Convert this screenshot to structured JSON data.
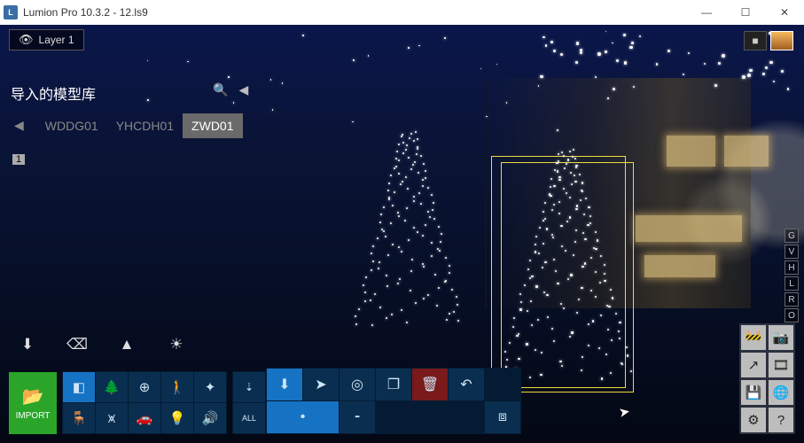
{
  "titlebar": {
    "app_icon_text": "L",
    "title": "Lumion Pro 10.3.2  - 12.ls9",
    "min": "—",
    "max": "☐",
    "close": "✕"
  },
  "layer_button": {
    "label": "Layer 1"
  },
  "library": {
    "title": "导入的模型库",
    "tabs": [
      "WDDG01",
      "YHCDH01",
      "ZWD01"
    ],
    "active_index": 2,
    "page": "1"
  },
  "top_thumbs": {
    "labels": [
      "camera",
      "scene"
    ],
    "active_index": 1
  },
  "rnav_letters": [
    "G",
    "V",
    "H",
    "L",
    "R",
    "O"
  ],
  "right_tools": {
    "items": [
      {
        "name": "worker-icon",
        "glyph": "🚧"
      },
      {
        "name": "camera-icon",
        "glyph": "📷"
      },
      {
        "name": "export-icon",
        "glyph": "↗"
      },
      {
        "name": "film-icon",
        "glyph": "🎞"
      },
      {
        "name": "save-icon",
        "glyph": "💾"
      },
      {
        "name": "globe-icon",
        "glyph": "🌐"
      },
      {
        "name": "gear-icon",
        "glyph": "⚙"
      },
      {
        "name": "help-icon",
        "glyph": "?"
      }
    ]
  },
  "mode_row": {
    "items": [
      {
        "name": "place-down-icon",
        "glyph": "⬇"
      },
      {
        "name": "eraser-icon",
        "glyph": "⌫"
      },
      {
        "name": "mountain-icon",
        "glyph": "▲"
      },
      {
        "name": "sun-icon",
        "glyph": "☀"
      }
    ]
  },
  "import_btn": {
    "label": "IMPORT"
  },
  "object_grid": {
    "row1": [
      {
        "name": "cube-icon",
        "glyph": "◧"
      },
      {
        "name": "tree-icon",
        "glyph": "🌲"
      },
      {
        "name": "tree-plus-icon",
        "glyph": "⊕"
      },
      {
        "name": "walk-icon",
        "glyph": "🚶"
      },
      {
        "name": "tools-icon",
        "glyph": "✦"
      }
    ],
    "row2": [
      {
        "name": "chair-icon",
        "glyph": "🪑"
      },
      {
        "name": "fence-icon",
        "glyph": "⩙"
      },
      {
        "name": "car-icon",
        "glyph": "🚗"
      },
      {
        "name": "light-icon",
        "glyph": "💡"
      },
      {
        "name": "sound-icon",
        "glyph": "🔊"
      }
    ],
    "active_index": 0
  },
  "side_col": {
    "top_glyph": "⇣",
    "all_label": "ALL"
  },
  "placement": {
    "row1": [
      {
        "name": "place-icon",
        "glyph": "⬇",
        "active": true
      },
      {
        "name": "pointer-icon",
        "glyph": "➤"
      },
      {
        "name": "rotate-icon",
        "glyph": "◎"
      },
      {
        "name": "scale-icon",
        "glyph": "❐"
      },
      {
        "name": "delete-icon",
        "glyph": "🗑",
        "del": true
      },
      {
        "name": "undo-icon",
        "glyph": "↶"
      },
      {
        "name": "blank1",
        "glyph": "",
        "blank": true
      }
    ],
    "row2": [
      {
        "name": "single-place-icon",
        "glyph": "•",
        "span2": true,
        "active": true
      },
      {
        "name": "line-place-icon",
        "glyph": "⁃"
      },
      {
        "name": "blank2",
        "glyph": "",
        "blank": true
      },
      {
        "name": "blank3",
        "glyph": "",
        "blank": true
      },
      {
        "name": "blank4",
        "glyph": "",
        "blank": true
      },
      {
        "name": "marquee-icon",
        "glyph": "⧈"
      }
    ]
  }
}
